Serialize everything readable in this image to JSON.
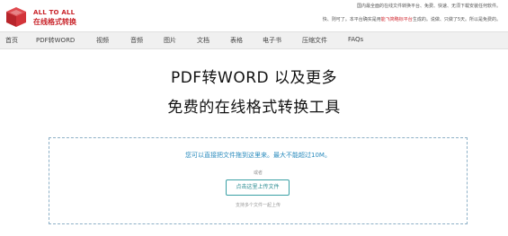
{
  "brand": {
    "title": "ALL TO ALL",
    "subtitle": "在线格式转换",
    "accent_color": "#c9252b",
    "logo_icon": "cube-logo-icon"
  },
  "notice": {
    "line1": "国内最全面的在线文件转换平台、免费、快速、无须下载安装任何软件。",
    "line2_before": "快、则可了。本平台确实是用",
    "line2_red": "能飞简略标平台",
    "line2_after": "生成的。说做、只做了5天。所以是免费的。"
  },
  "nav": {
    "items": [
      "首页",
      "PDF转WORD",
      "视频",
      "音频",
      "图片",
      "文档",
      "表格",
      "电子书",
      "压缩文件",
      "FAQs"
    ]
  },
  "hero": {
    "line1": "PDF转WORD 以及更多",
    "line2": "免费的在线格式转换工具"
  },
  "upload": {
    "hint": "您可以直接把文件拖到这里来。最大不能超过10M。",
    "or": "或者",
    "button": "点击这里上传文件",
    "multi": "支持多个文件一起上传",
    "border_color": "#8db0c7",
    "button_color": "#3aa0a5"
  }
}
